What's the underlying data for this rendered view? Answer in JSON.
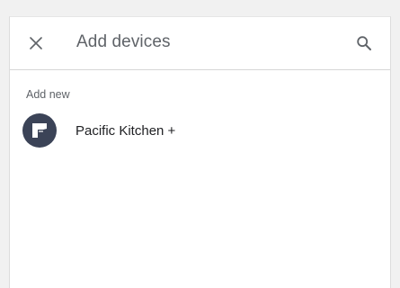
{
  "header": {
    "title": "Add devices",
    "close_icon": "close-icon",
    "search_icon": "search-icon"
  },
  "section": {
    "label": "Add new"
  },
  "devices": [
    {
      "name": "Pacific Kitchen +",
      "icon": "device-avatar-icon"
    }
  ],
  "colors": {
    "avatar_bg": "#3b4357",
    "title": "#5f6368",
    "text": "#202124"
  }
}
